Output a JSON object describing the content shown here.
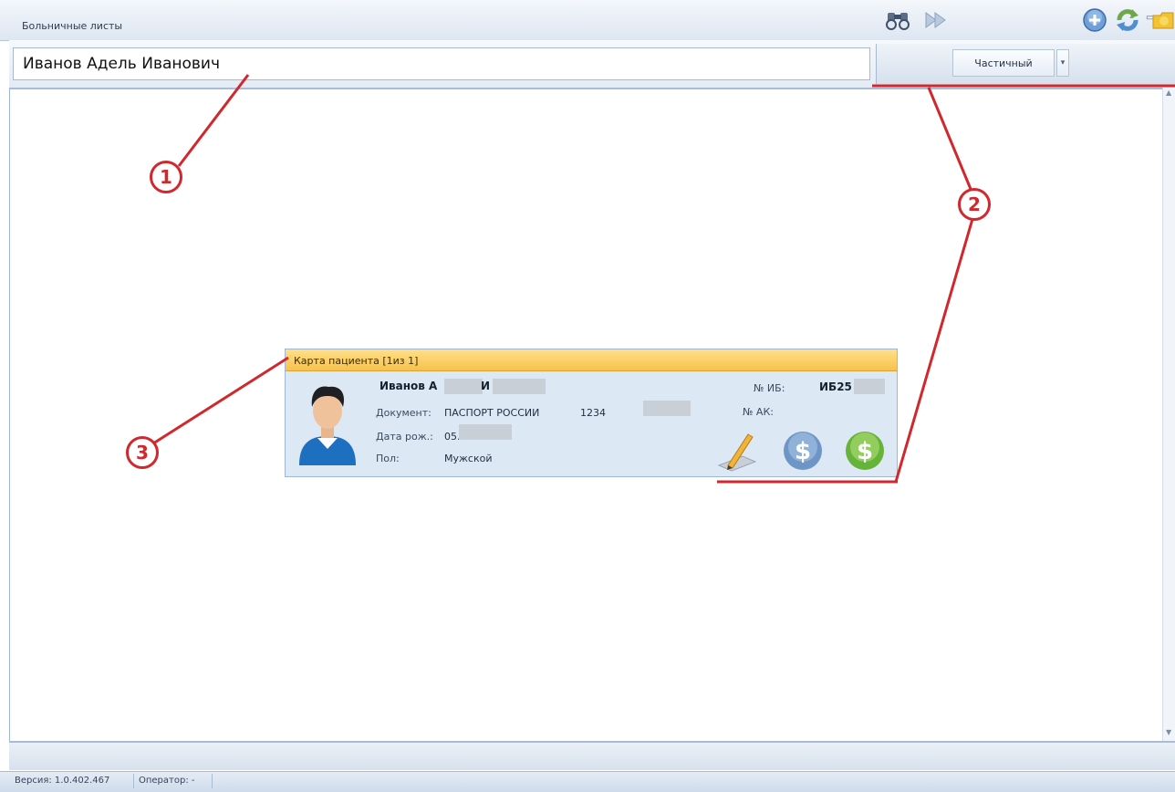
{
  "window": {
    "title": "Больничные листы",
    "min": "–",
    "restore": "▭",
    "close": "x"
  },
  "search": {
    "value": "Иванов Адель Иванович"
  },
  "toolbar": {
    "mode_value": "Частичный",
    "icons": [
      "binoculars-icon",
      "fast-forward-icon",
      "add-icon",
      "refresh-icon",
      "folder-icon"
    ]
  },
  "card": {
    "title": "Карта пациента [1из 1]",
    "name": "Иванов А",
    "name_initial": "И",
    "document_label": "Документ:",
    "document_type": "ПАСПОРТ РОССИИ",
    "document_series": "1234",
    "birth_label": "Дата рож.:",
    "birth_value": "05.",
    "sex_label": "Пол:",
    "sex_value": "Мужской",
    "ib_label": "№ ИБ:",
    "ib_value": "ИБ25",
    "ak_label": "№ АК:"
  },
  "status": {
    "version": "Версия: 1.0.402.467",
    "operator": "Оператор: -"
  },
  "annotations": {
    "one": "1",
    "two": "2",
    "three": "3"
  },
  "colors": {
    "annotation_red": "#d0282c",
    "card_header": "#f7c24a",
    "chrome_blue": "#a8bcd6"
  }
}
